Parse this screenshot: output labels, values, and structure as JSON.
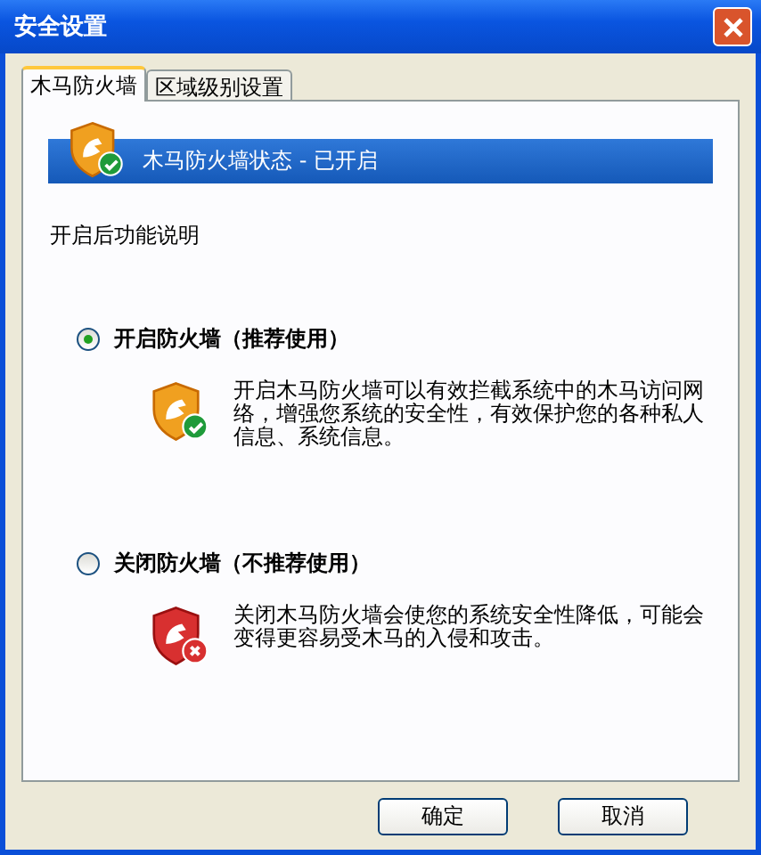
{
  "window": {
    "title": "安全设置"
  },
  "tabs": [
    {
      "label": "木马防火墙",
      "selected": true
    },
    {
      "label": "区域级别设置",
      "selected": false
    }
  ],
  "status_banner": {
    "kind": "on",
    "text": "木马防火墙状态 - 已开启"
  },
  "section_label": "开启后功能说明",
  "options": [
    {
      "kind": "on",
      "selected": true,
      "label": "开启防火墙（推荐使用）",
      "description": "开启木马防火墙可以有效拦截系统中的木马访问网络，增强您系统的安全性，有效保护您的各种私人信息、系统信息。"
    },
    {
      "kind": "off",
      "selected": false,
      "label": "关闭防火墙（不推荐使用）",
      "description": "关闭木马防火墙会使您的系统安全性降低，可能会变得更容易受木马的入侵和攻击。"
    }
  ],
  "buttons": [
    "确定",
    "取消"
  ]
}
